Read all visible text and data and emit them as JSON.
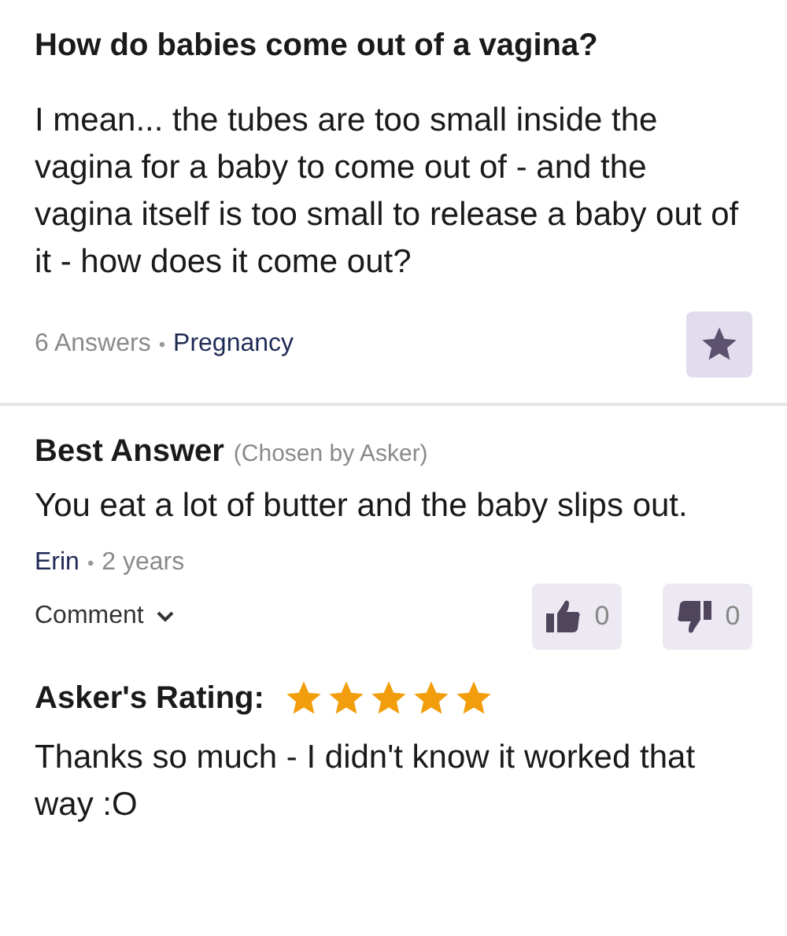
{
  "question": {
    "title": "How do babies come out of a vagina?",
    "body": "I mean... the tubes are too small inside the vagina for a baby to come out of - and the vagina itself is too small to release a baby out of it - how does it come out?",
    "answers_count": "6 Answers",
    "separator": "•",
    "category": "Pregnancy"
  },
  "answer": {
    "heading": "Best Answer",
    "chosen_note": "(Chosen by Asker)",
    "body": "You eat a lot of butter and the baby slips out.",
    "author": "Erin",
    "separator": "•",
    "age": "2 years",
    "comment_label": "Comment",
    "thumbs_up_count": "0",
    "thumbs_down_count": "0"
  },
  "rating": {
    "label": "Asker's Rating:",
    "stars": 5,
    "comment": "Thanks so much - I didn't know it worked that way :O"
  }
}
